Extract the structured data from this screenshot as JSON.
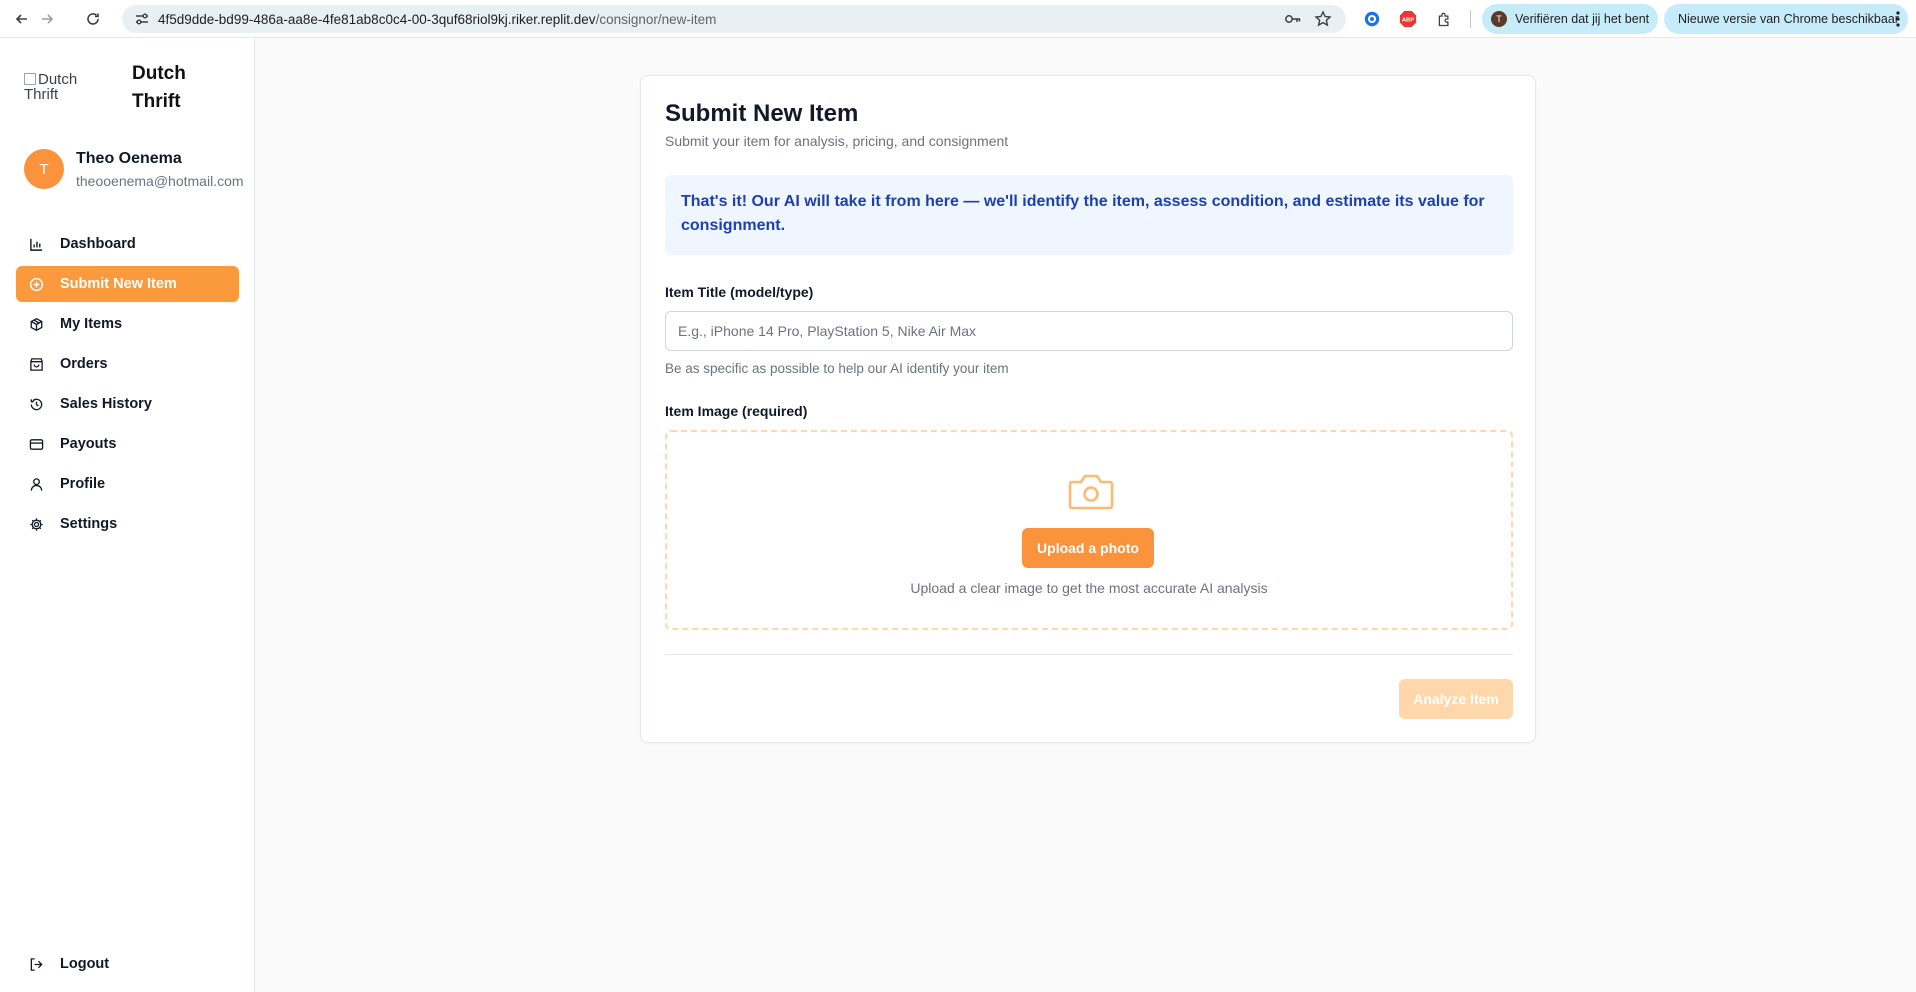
{
  "browser": {
    "url_host": "4f5d9dde-bd99-486a-aa8e-4fe81ab8c0c4-00-3quf68riol9kj.riker.replit.dev",
    "url_path": "/consignor/new-item",
    "verify_pill": "Verifiëren dat jij het bent",
    "verify_avatar": "T",
    "update_pill": "Nieuwe versie van Chrome beschikbaar",
    "ext_abp": "ABP"
  },
  "sidebar": {
    "logo_alt": "Dutch Thrift",
    "brand_line1": "Dutch",
    "brand_line2": "Thrift",
    "user": {
      "initial": "T",
      "name": "Theo Oenema",
      "email": "theooenema@hotmail.com"
    },
    "menu": [
      {
        "label": "Dashboard",
        "icon": "bar-chart-icon"
      },
      {
        "label": "Submit New Item",
        "icon": "plus-circle-icon",
        "active": true
      },
      {
        "label": "My Items",
        "icon": "package-icon"
      },
      {
        "label": "Orders",
        "icon": "shopping-bag-icon"
      },
      {
        "label": "Sales History",
        "icon": "history-icon"
      },
      {
        "label": "Payouts",
        "icon": "credit-card-icon"
      },
      {
        "label": "Profile",
        "icon": "user-icon"
      },
      {
        "label": "Settings",
        "icon": "gear-icon"
      }
    ],
    "logout": "Logout"
  },
  "form": {
    "title": "Submit New Item",
    "subtitle": "Submit your item for analysis, pricing, and consignment",
    "info": "That's it! Our AI will take it from here — we'll identify the item, assess condition, and estimate its value for consignment.",
    "item_title_label": "Item Title (model/type)",
    "item_title_placeholder": "E.g., iPhone 14 Pro, PlayStation 5, Nike Air Max",
    "item_title_value": "",
    "item_title_help": "Be as specific as possible to help our AI identify your item",
    "image_label": "Item Image (required)",
    "upload_button": "Upload a photo",
    "upload_help": "Upload a clear image to get the most accurate AI analysis",
    "analyze_button": "Analyze Item"
  },
  "colors": {
    "accent": "#fb923c",
    "accent_disabled": "#fed7aa",
    "info_bg": "#eff6ff",
    "info_text": "#1e40af"
  }
}
